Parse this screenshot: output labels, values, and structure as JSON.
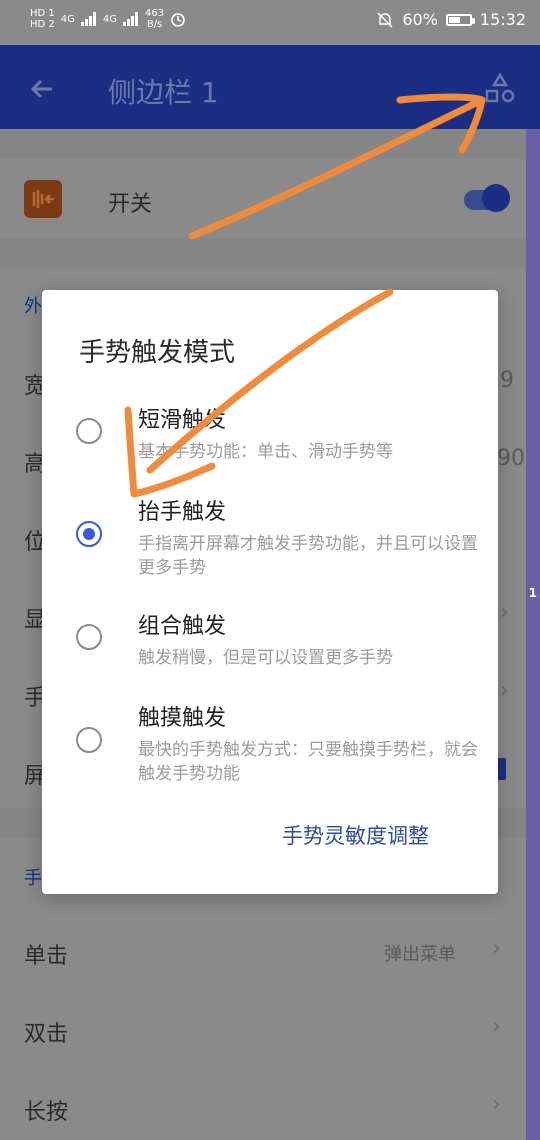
{
  "status_bar": {
    "sim1": "HD 1",
    "sim2": "HD 2",
    "net1": "4G",
    "net2": "4G",
    "speed": "463",
    "speed_unit": "B/s",
    "battery": "60%",
    "battery_level": 0.6,
    "time": "15:32"
  },
  "appbar": {
    "title": "侧边栏 1"
  },
  "background": {
    "switch_label": "开关",
    "section1_header": "外",
    "rows": [
      "宽",
      "高",
      "位",
      "显",
      "手",
      "屏"
    ],
    "row_values": {
      "width_tail": "9",
      "height_tail": "90"
    },
    "section2_header": "手",
    "actions": [
      {
        "label": "单击",
        "value": "弹出菜单"
      },
      {
        "label": "双击",
        "value": ""
      },
      {
        "label": "长按",
        "value": ""
      }
    ]
  },
  "right_scroll_label": "1",
  "dialog": {
    "title": "手势触发模式",
    "options": [
      {
        "title": "短滑触发",
        "desc": "基本手势功能：单击、滑动手势等",
        "checked": false
      },
      {
        "title": "抬手触发",
        "desc": "手指离开屏幕才触发手势功能，并且可以设置更多手势",
        "checked": true
      },
      {
        "title": "组合触发",
        "desc": "触发稍慢，但是可以设置更多手势",
        "checked": false
      },
      {
        "title": "触摸触发",
        "desc": "最快的手势触发方式：只要触摸手势栏，就会触发手势功能",
        "checked": false
      }
    ],
    "action_label": "手势灵敏度调整"
  },
  "colors": {
    "accent": "#3b57e0",
    "appbar": "#1b2e84",
    "annotation": "#f08a3c"
  }
}
